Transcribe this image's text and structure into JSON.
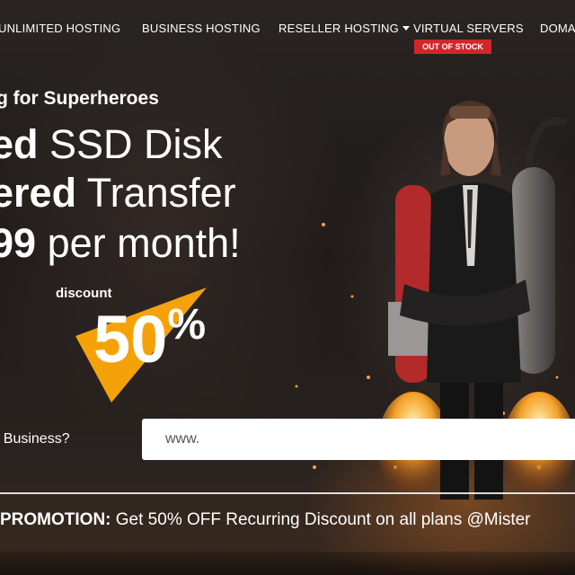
{
  "nav": {
    "items": [
      {
        "label": "UNLIMITED HOSTING",
        "dropdown": false
      },
      {
        "label": "BUSINESS HOSTING",
        "dropdown": false
      },
      {
        "label": "RESELLER HOSTING",
        "dropdown": true
      },
      {
        "label": "VIRTUAL SERVERS",
        "dropdown": false
      },
      {
        "label": "DOMA",
        "dropdown": false
      }
    ],
    "badge": "OUT OF STOCK"
  },
  "hero": {
    "tagline": "g for Superheroes",
    "line1_bold": "ed",
    "line1_rest": " SSD Disk",
    "line2_bold": "ered",
    "line2_rest": " Transfer",
    "line3_bold": "99",
    "line3_rest": " per month!",
    "discount_label": "discount",
    "discount_value": "50",
    "discount_symbol": "%"
  },
  "search": {
    "label": "r Business?",
    "value": "www."
  },
  "promo": {
    "bold": " PROMOTION:",
    "text": " Get 50% OFF Recurring Discount on all plans @Mister"
  },
  "colors": {
    "badge": "#d3262b",
    "discount_shape": "#f5a20a",
    "text": "#ffffff"
  },
  "icons": [
    "chevron-down-icon",
    "superhero-jetpack-illustration"
  ]
}
